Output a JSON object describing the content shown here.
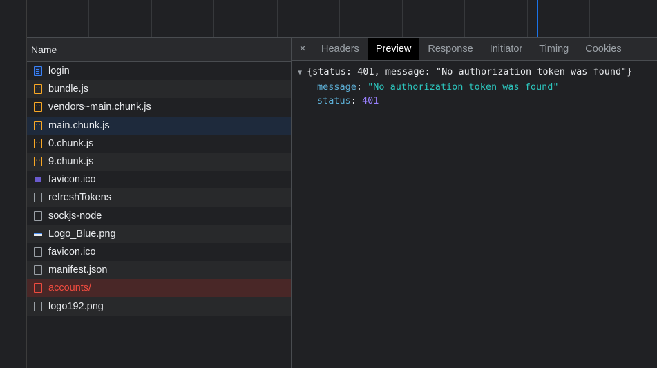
{
  "network_list": {
    "header": "Name",
    "requests": [
      {
        "name": "login",
        "icon": "document-icon"
      },
      {
        "name": "bundle.js",
        "icon": "script-icon"
      },
      {
        "name": "vendors~main.chunk.js",
        "icon": "script-icon"
      },
      {
        "name": "main.chunk.js",
        "icon": "script-icon",
        "selected": true
      },
      {
        "name": "0.chunk.js",
        "icon": "script-icon"
      },
      {
        "name": "9.chunk.js",
        "icon": "script-icon"
      },
      {
        "name": "favicon.ico",
        "icon": "image-icon"
      },
      {
        "name": "refreshTokens",
        "icon": "file-icon"
      },
      {
        "name": "sockjs-node",
        "icon": "file-icon"
      },
      {
        "name": "Logo_Blue.png",
        "icon": "image-icon"
      },
      {
        "name": "favicon.ico",
        "icon": "file-icon"
      },
      {
        "name": "manifest.json",
        "icon": "file-icon"
      },
      {
        "name": "accounts/",
        "icon": "file-icon",
        "error": true
      },
      {
        "name": "logo192.png",
        "icon": "file-icon"
      }
    ]
  },
  "detail": {
    "close": "×",
    "tabs": [
      {
        "label": "Headers"
      },
      {
        "label": "Preview",
        "active": true
      },
      {
        "label": "Response"
      },
      {
        "label": "Initiator"
      },
      {
        "label": "Timing"
      },
      {
        "label": "Cookies"
      }
    ],
    "preview": {
      "caret": "▼",
      "summary": "{status: 401, message: \"No authorization token was found\"}",
      "message_key": "message",
      "message_value": "\"No authorization token was found\"",
      "status_key": "status",
      "status_value": "401"
    }
  },
  "colors": {
    "accent": "#1a73e8",
    "error": "#ee4b3f",
    "selected_row": "#1e2a3c",
    "json_key": "#5db0d7",
    "json_string": "#2cc5bd",
    "json_number": "#9980ff"
  }
}
